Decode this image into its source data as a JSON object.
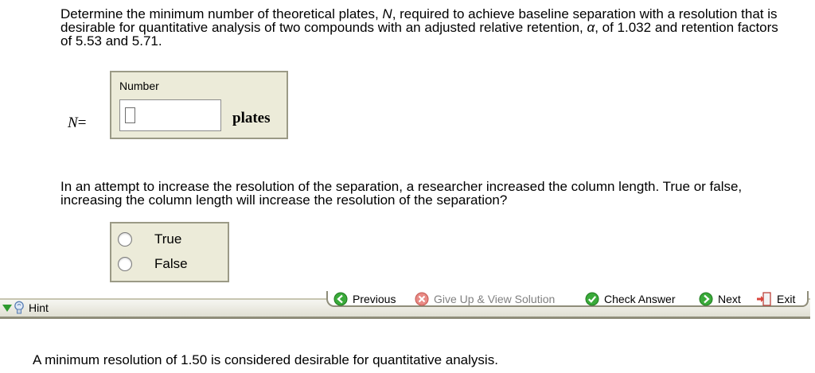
{
  "question1": {
    "text_part1": "Determine the minimum number of theoretical plates, ",
    "text_var": "N",
    "text_part2": ", required to achieve baseline separation with a resolution that is desirable for quantitative analysis of two compounds with an adjusted relative retention, ",
    "text_alpha": "α",
    "text_part3": ", of 1.032 and retention factors of 5.53 and 5.71."
  },
  "answer": {
    "variable_label": "N",
    "equals": "=",
    "caption": "Number",
    "value": "",
    "unit": "plates"
  },
  "question2": {
    "text": "In an attempt to increase the resolution of the separation, a researcher increased the column length. True or false, increasing the column length will increase the resolution of the separation?",
    "options": [
      "True",
      "False"
    ]
  },
  "toolbar": {
    "hint": "Hint",
    "previous": "Previous",
    "give_up": "Give Up & View Solution",
    "check_answer": "Check Answer",
    "next": "Next",
    "exit": "Exit",
    "accent_green": "#2e9a2e",
    "accent_red": "#d9453c"
  },
  "hint_text": "A minimum resolution of 1.50 is considered desirable for quantitative analysis."
}
